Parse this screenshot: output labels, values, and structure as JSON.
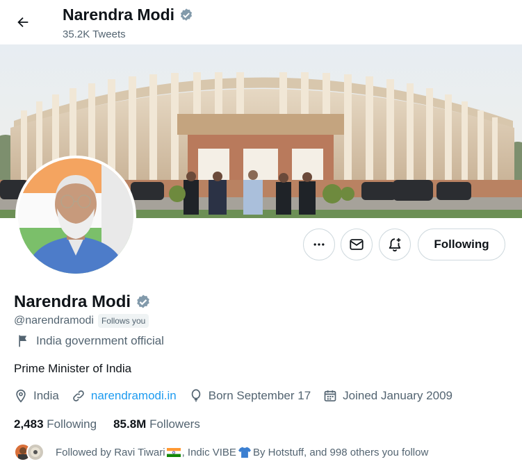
{
  "header": {
    "name": "Narendra Modi",
    "tweet_count": "35.2K Tweets"
  },
  "profile": {
    "name": "Narendra Modi",
    "handle": "@narendramodi",
    "follows_you": "Follows you",
    "label": "India government official",
    "bio": "Prime Minister of India",
    "location": "India",
    "website": "narendramodi.in",
    "born": "Born September 17",
    "joined": "Joined January 2009",
    "following_count": "2,483",
    "following_label": "Following",
    "followers_count": "85.8M",
    "followers_label": "Followers",
    "followed_by_prefix": "Followed by Ravi Tiwari",
    "followed_by_middle": ", Indic VIBE ",
    "followed_by_suffix": " By Hotstuff, and 998 others you follow"
  },
  "actions": {
    "following_button": "Following"
  },
  "icons": {
    "back": "arrow-left-icon",
    "verified": "verified-badge-icon",
    "more": "more-dots-icon",
    "message": "envelope-icon",
    "notify": "bell-plus-icon",
    "label": "flag-icon",
    "location": "location-pin-icon",
    "link": "link-icon",
    "birthday": "balloon-icon",
    "calendar": "calendar-icon"
  },
  "colors": {
    "accent": "#1d9bf0",
    "text_primary": "#0f1419",
    "text_secondary": "#536471",
    "verified_badge": "#829aab",
    "border": "#cfd9de"
  }
}
